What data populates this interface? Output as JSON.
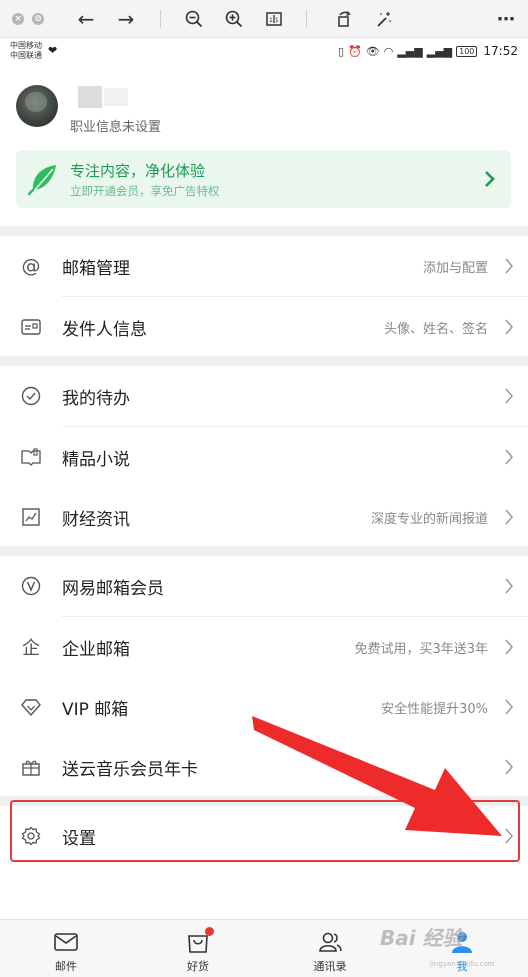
{
  "status": {
    "carrier1": "中国移动",
    "carrier2": "中国联通",
    "battery": "100",
    "time": "17:52"
  },
  "profile": {
    "job_info": "职业信息未设置"
  },
  "vip_banner": {
    "title": "专注内容，净化体验",
    "subtitle": "立即开通会员，享免广告特权"
  },
  "groups": [
    [
      {
        "label": "邮箱管理",
        "sub": "添加与配置",
        "icon": "at-icon"
      },
      {
        "label": "发件人信息",
        "sub": "头像、姓名、签名",
        "icon": "id-card-icon"
      }
    ],
    [
      {
        "label": "我的待办",
        "sub": "",
        "icon": "check-circle-icon"
      },
      {
        "label": "精品小说",
        "sub": "",
        "icon": "book-icon"
      },
      {
        "label": "财经资讯",
        "sub": "深度专业的新闻报道",
        "icon": "chart-icon"
      }
    ],
    [
      {
        "label": "网易邮箱会员",
        "sub": "",
        "icon": "vip-badge-icon"
      },
      {
        "label": "企业邮箱",
        "sub": "免费试用，买3年送3年",
        "icon": "enterprise-icon"
      },
      {
        "label": "VIP 邮箱",
        "sub": "安全性能提升30%",
        "icon": "diamond-icon"
      },
      {
        "label": "送云音乐会员年卡",
        "sub": "",
        "icon": "gift-icon"
      }
    ],
    [
      {
        "label": "设置",
        "sub": "",
        "icon": "gear-icon"
      }
    ]
  ],
  "nav": {
    "mail": "邮件",
    "goods": "好货",
    "contacts": "通讯录",
    "me": "我"
  },
  "watermark": "Bai 经验",
  "watermark_sub": "jingyan.baidu.com",
  "colors": {
    "accent": "#1d9a4f",
    "banner_bg": "#e9f7ee",
    "highlight": "#e23b3b",
    "me_active": "#2f8ee5"
  }
}
